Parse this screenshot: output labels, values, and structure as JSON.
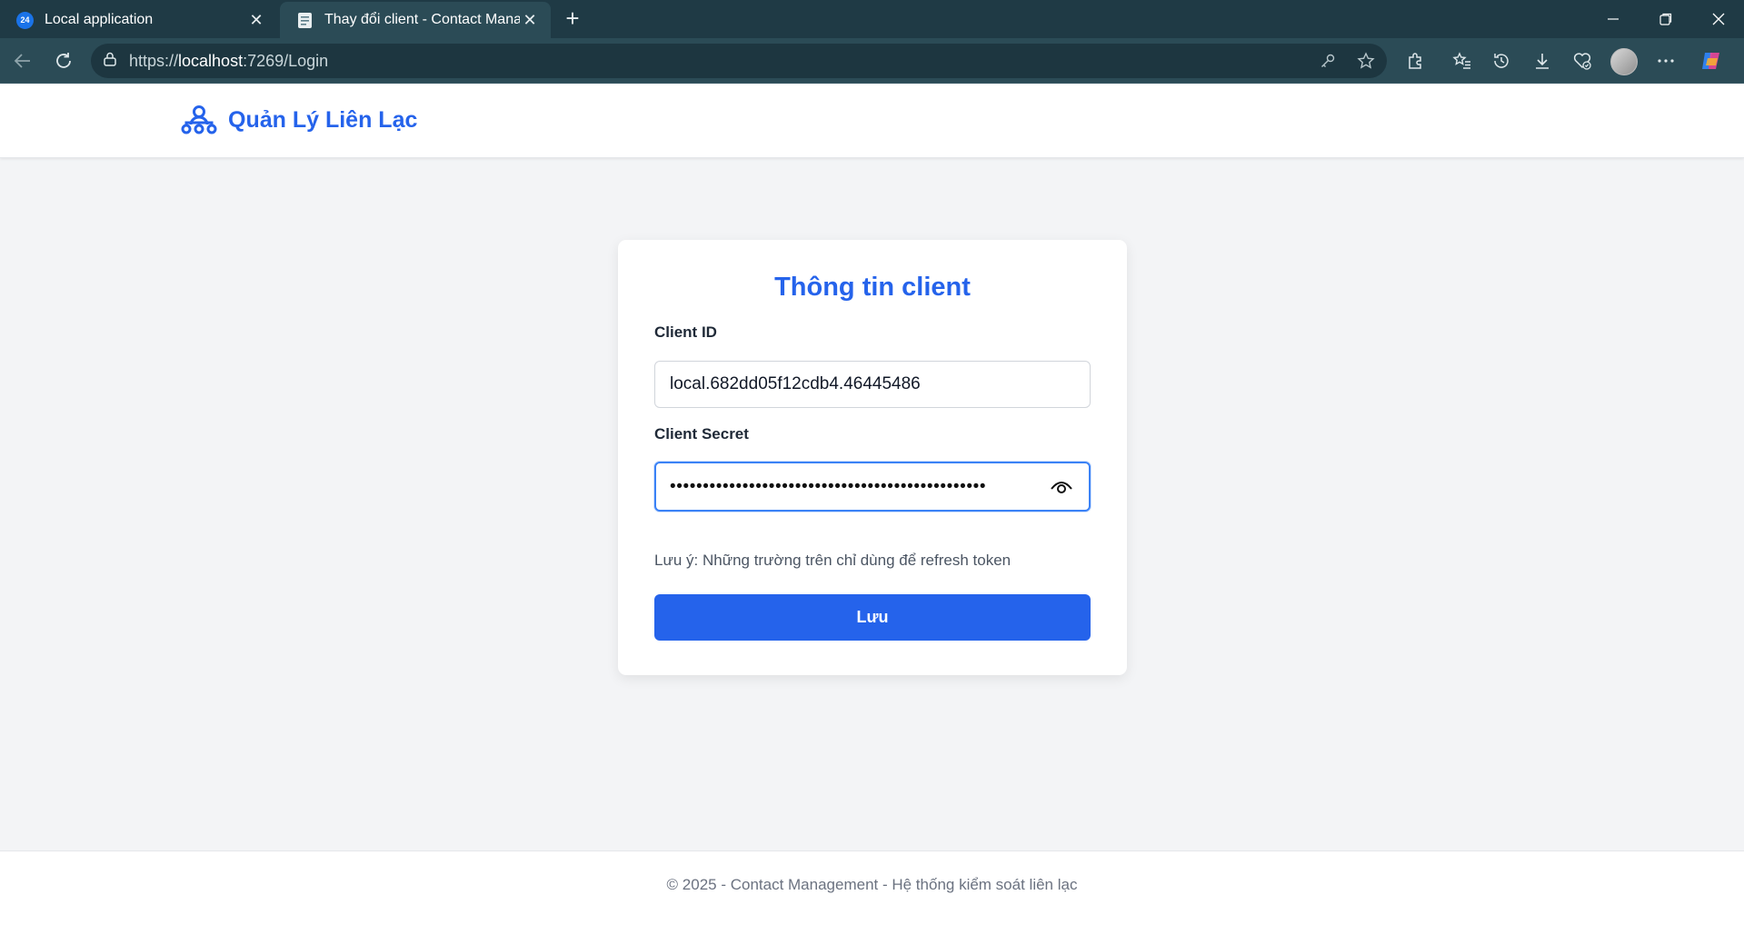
{
  "browser": {
    "tabs": [
      {
        "title": "Local application",
        "favicon_text": "24"
      },
      {
        "title": "Thay đổi client - Contact Management"
      }
    ],
    "url_prefix": "https://",
    "url_host": "localhost",
    "url_rest": ":7269/Login"
  },
  "app": {
    "brand": "Quản Lý Liên Lạc"
  },
  "form": {
    "title": "Thông tin client",
    "client_id_label": "Client ID",
    "client_id_value": "local.682dd05f12cdb4.46445486",
    "client_secret_label": "Client Secret",
    "client_secret_masked": "••••••••••••••••••••••••••••••••••••••••••••••••",
    "note": "Lưu ý: Những trường trên chỉ dùng để refresh token",
    "save_label": "Lưu"
  },
  "footer": {
    "text": "© 2025 - Contact Management - Hệ thống kiểm soát liên lạc"
  },
  "colors": {
    "primary": "#2563eb",
    "page_bg": "#f3f4f6",
    "browser_frame": "#1f3a45"
  }
}
